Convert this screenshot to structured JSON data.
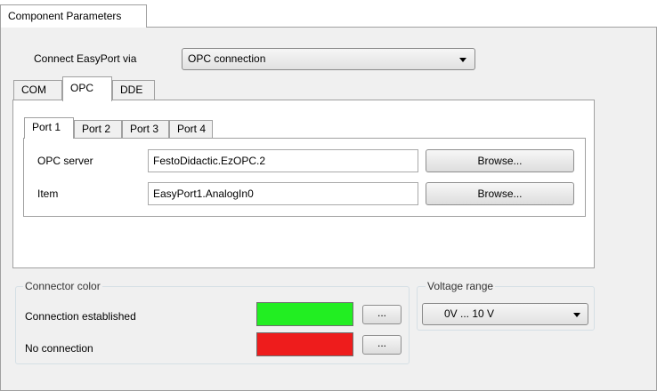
{
  "outer_tab": {
    "label": "Component Parameters"
  },
  "connect": {
    "label": "Connect EasyPort via",
    "selected": "OPC connection"
  },
  "protocol_tabs": [
    "COM",
    "OPC",
    "DDE"
  ],
  "port_tabs": [
    "Port 1",
    "Port 2",
    "Port 3",
    "Port 4"
  ],
  "opc": {
    "server_label": "OPC server",
    "server_value": "FestoDidactic.EzOPC.2",
    "item_label": "Item",
    "item_value": "EasyPort1.AnalogIn0",
    "browse_label": "Browse..."
  },
  "connector_color": {
    "title": "Connector color",
    "established_label": "Connection established",
    "established_color": "#22ee22",
    "none_label": "No connection",
    "none_color": "#ee1c1c",
    "pick_label": "..."
  },
  "voltage": {
    "title": "Voltage range",
    "selected": "0V ... 10 V"
  }
}
